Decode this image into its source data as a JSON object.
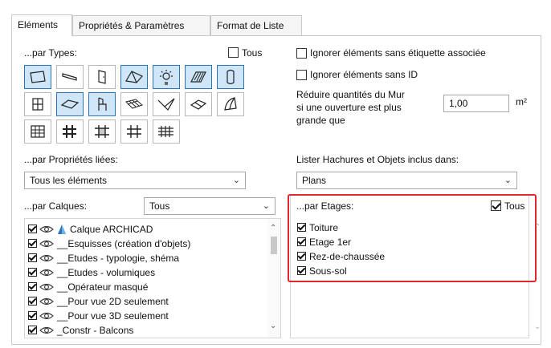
{
  "tabs": [
    {
      "label": "Eléments",
      "active": true
    },
    {
      "label": "Propriétés & Paramètres",
      "active": false
    },
    {
      "label": "Format de Liste",
      "active": false
    }
  ],
  "types": {
    "label": "...par Types:",
    "all_label": "Tous",
    "all_checked": false,
    "rows": [
      [
        {
          "icon": "wall-icon",
          "selected": true
        },
        {
          "icon": "beam-icon",
          "selected": false
        },
        {
          "icon": "door-icon",
          "selected": false
        },
        {
          "icon": "roof-icon",
          "selected": true
        },
        {
          "icon": "lamp-icon",
          "selected": true
        },
        {
          "icon": "fill-icon",
          "selected": true
        },
        {
          "icon": "column-icon",
          "selected": true
        }
      ],
      [
        {
          "icon": "window-icon",
          "selected": false
        },
        {
          "icon": "slab-icon",
          "selected": true
        },
        {
          "icon": "chair-icon",
          "selected": true
        },
        {
          "icon": "mesh-icon",
          "selected": false
        },
        {
          "icon": "morph-icon",
          "selected": false
        },
        {
          "icon": "stair-icon",
          "selected": false
        },
        {
          "icon": "shell-icon",
          "selected": false
        }
      ],
      [
        {
          "icon": "curtain-wall-icon",
          "selected": false
        },
        {
          "icon": "grid-hash-icon",
          "selected": false
        },
        {
          "icon": "grid-frame-icon",
          "selected": false
        },
        {
          "icon": "grid-cross-icon",
          "selected": false
        },
        {
          "icon": "grid-multi-icon",
          "selected": false
        }
      ]
    ]
  },
  "options": {
    "ignore_unlabeled": "Ignorer éléments sans étiquette associée",
    "ignore_no_id": "Ignorer éléments sans ID",
    "reduce_wall_text": [
      "Réduire quantités du Mur",
      "si une ouverture est plus",
      "grande que"
    ],
    "reduce_value": "1,00",
    "reduce_unit": "m²"
  },
  "linked_props": {
    "label": "...par Propriétés liées:",
    "value": "Tous les éléments"
  },
  "hatches": {
    "label": "Lister Hachures et Objets inclus dans:",
    "value": "Plans"
  },
  "layers": {
    "label": "...par Calques:",
    "filter_value": "Tous",
    "items": [
      "Calque ARCHICAD",
      "__Esquisses (création d'objets)",
      "__Etudes - typologie, shéma",
      "__Etudes - volumiques",
      "__Opérateur masqué",
      "__Pour vue 2D seulement",
      "__Pour vue 3D seulement",
      "_Constr - Balcons"
    ]
  },
  "stories": {
    "label": "...par Etages:",
    "all_label": "Tous",
    "all_checked": true,
    "items": [
      "Toiture",
      "Etage 1er",
      "Rez-de-chaussée",
      "Sous-sol"
    ]
  },
  "colors": {
    "accent": "#2d73b8",
    "highlight": "#e3262e",
    "selected_bg": "#cfe6f8"
  }
}
